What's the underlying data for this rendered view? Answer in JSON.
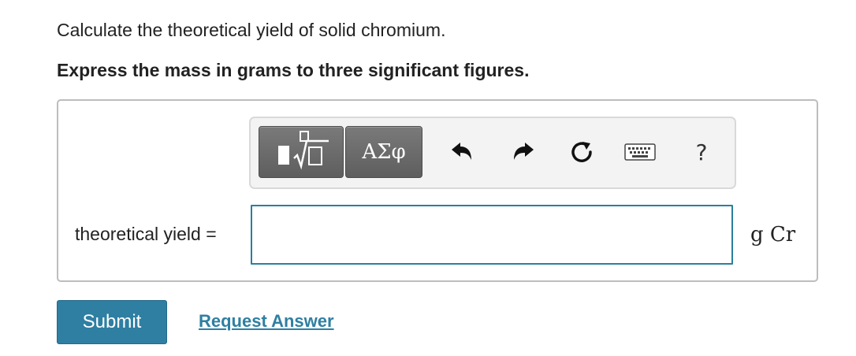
{
  "question": {
    "prompt": "Calculate the theoretical yield of solid chromium.",
    "instruction": "Express the mass in grams to three significant figures."
  },
  "toolbar": {
    "templates_icon": "templates-sqrt-icon",
    "greek_label": "ΑΣφ",
    "undo_icon": "undo-icon",
    "redo_icon": "redo-icon",
    "reset_icon": "reset-icon",
    "keyboard_icon": "keyboard-icon",
    "help_label": "?"
  },
  "answer": {
    "label": "theoretical yield =",
    "value": "",
    "unit": "g Cr"
  },
  "actions": {
    "submit_label": "Submit",
    "request_label": "Request Answer"
  },
  "colors": {
    "accent": "#2e7fa2",
    "toolbar_button": "#6b6b6b",
    "input_border": "#2a7f9e"
  }
}
